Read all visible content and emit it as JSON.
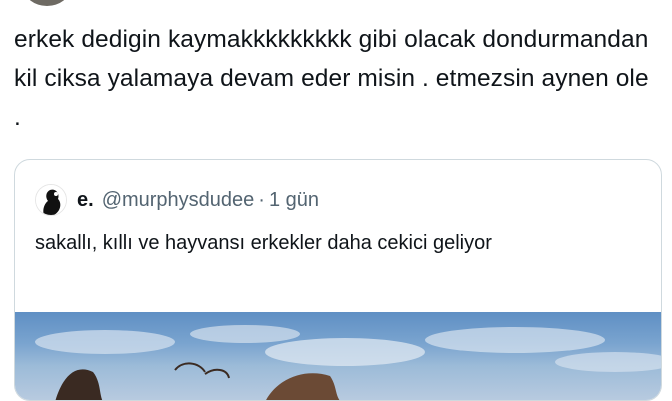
{
  "tweet": {
    "text": "erkek dedigin kaymakkkkkkkkk gibi olacak dondurmandan kil ciksa yalamaya devam eder misin . etmezsin aynen ole ."
  },
  "quoted": {
    "name": "e.",
    "handle": "@murphysdudee",
    "separator": "·",
    "time": "1 gün",
    "text": "sakallı, kıllı ve hayvansı erkekler daha cekici geliyor",
    "avatar_icon": "profile-avatar",
    "media_icon": "sky-photo"
  }
}
